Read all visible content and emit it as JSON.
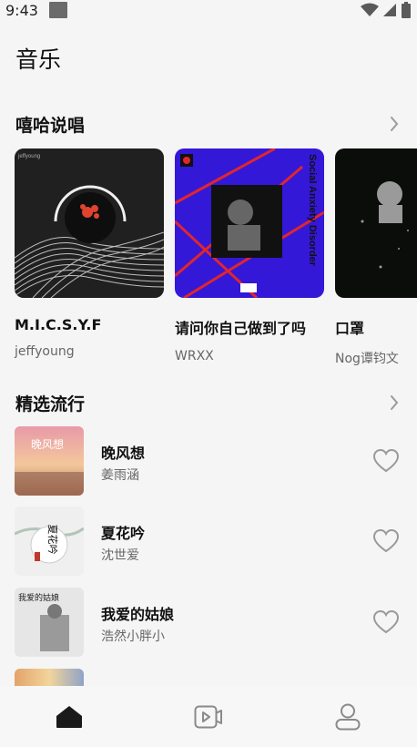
{
  "status_bar": {
    "time": "9:43"
  },
  "page": {
    "title": "音乐"
  },
  "hiphop": {
    "title": "嘻哈说唱",
    "albums": [
      {
        "title": "M.I.C.S.Y.F",
        "artist": "jeffyoung"
      },
      {
        "title": "请问你自己做到了吗",
        "artist": "WRXX",
        "cover_text": "Social Anxiety Disorder"
      },
      {
        "title": "口罩",
        "artist": "Nog谭钧文"
      }
    ]
  },
  "pop": {
    "title": "精选流行",
    "songs": [
      {
        "title": "晚风想",
        "artist": "姜雨涵",
        "cover_text": "晚风想"
      },
      {
        "title": "夏花吟",
        "artist": "沈世爱",
        "cover_text": "夏花吟"
      },
      {
        "title": "我爱的姑娘",
        "artist": "浩然小胖小",
        "cover_text": "我爱的姑娘"
      },
      {
        "title": "",
        "artist": ""
      }
    ]
  },
  "colors": {
    "background": "#f5f5f5",
    "text_primary": "#111111",
    "text_secondary": "#666666",
    "icon_gray": "#8a8a8a"
  },
  "icons": {
    "chevron": "chevron-right-icon",
    "heart": "heart-outline-icon",
    "nav": [
      "home-icon",
      "video-icon",
      "profile-icon"
    ]
  }
}
